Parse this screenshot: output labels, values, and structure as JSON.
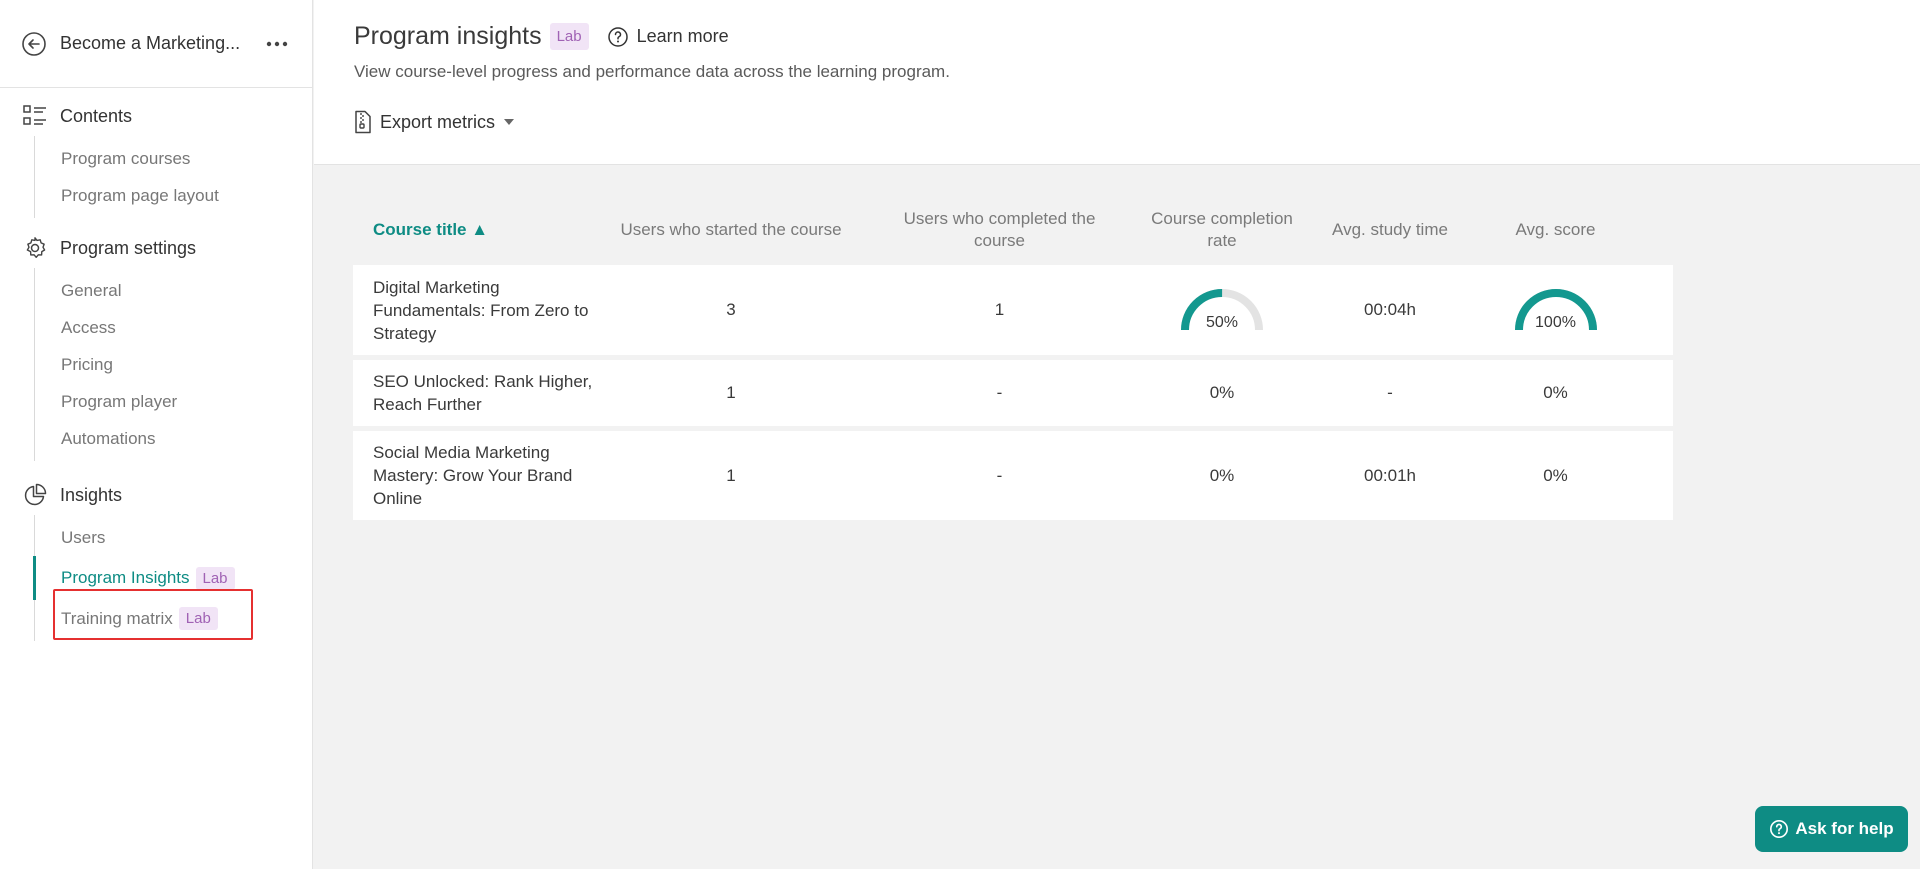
{
  "sidebar": {
    "program_title": "Become a Marketing...",
    "sections": [
      {
        "label": "Contents",
        "icon": "list-icon",
        "items": [
          {
            "label": "Program courses"
          },
          {
            "label": "Program page layout"
          }
        ]
      },
      {
        "label": "Program settings",
        "icon": "gear-icon",
        "items": [
          {
            "label": "General"
          },
          {
            "label": "Access"
          },
          {
            "label": "Pricing"
          },
          {
            "label": "Program player"
          },
          {
            "label": "Automations"
          }
        ]
      },
      {
        "label": "Insights",
        "icon": "pie-chart-icon",
        "items": [
          {
            "label": "Users"
          },
          {
            "label": "Program Insights",
            "badge": "Lab",
            "active": true
          },
          {
            "label": "Training matrix",
            "badge": "Lab"
          }
        ]
      }
    ]
  },
  "header": {
    "title": "Program insights",
    "badge": "Lab",
    "learn_more": "Learn more",
    "subtitle": "View course-level progress and performance data across the learning program.",
    "export_label": "Export metrics"
  },
  "table": {
    "columns": [
      "Course title ▲",
      "Users who started the course",
      "Users who completed the course",
      "Course completion rate",
      "Avg. study time",
      "Avg. score"
    ],
    "rows": [
      {
        "title": "Digital Marketing Fundamentals: From Zero to Strategy",
        "started": "3",
        "completed": "1",
        "completion_rate": "50%",
        "completion_fraction": 0.5,
        "study_time": "00:04h",
        "score": "100%",
        "score_fraction": 1.0,
        "gauges": true
      },
      {
        "title": "SEO Unlocked: Rank Higher, Reach Further",
        "started": "1",
        "completed": "-",
        "completion_rate": "0%",
        "study_time": "-",
        "score": "0%",
        "gauges": false
      },
      {
        "title": "Social Media Marketing Mastery: Grow Your Brand Online",
        "started": "1",
        "completed": "-",
        "completion_rate": "0%",
        "study_time": "00:01h",
        "score": "0%",
        "gauges": false
      }
    ]
  },
  "help_button": "Ask for help",
  "colors": {
    "accent": "#0e8c84",
    "lab_bg": "#f1e4f6",
    "lab_text": "#a062b4",
    "highlight": "#e53030"
  }
}
